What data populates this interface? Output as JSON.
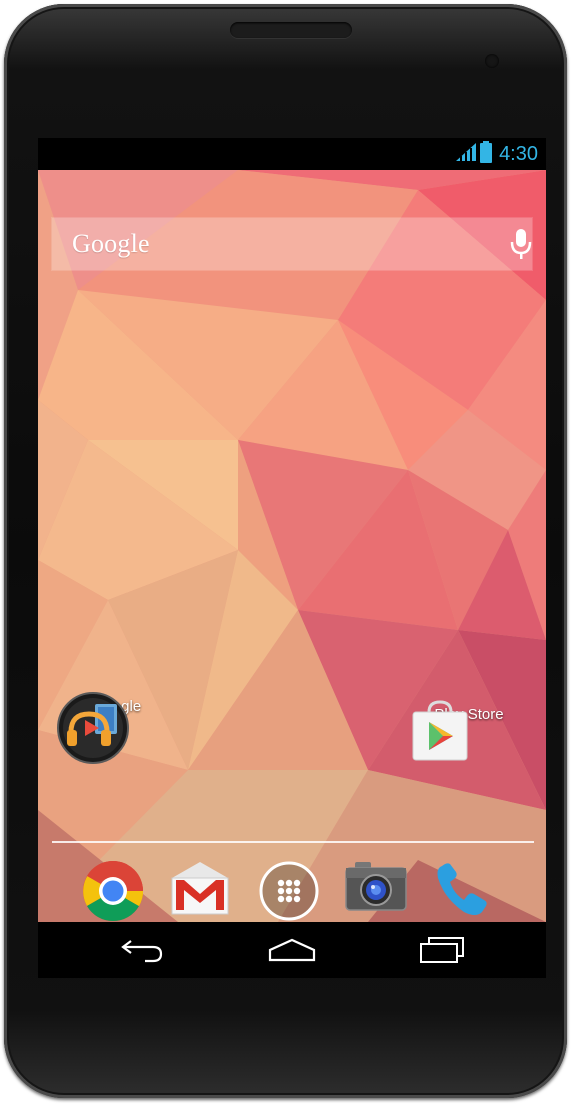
{
  "status_bar": {
    "time": "4:30",
    "icons": [
      "signal-icon",
      "battery-icon"
    ],
    "accent_color": "#33b5e5"
  },
  "search_widget": {
    "label": "Google",
    "icon": "mic-icon"
  },
  "home_apps": [
    {
      "label": "Google",
      "icon": "google-music-folder-icon"
    },
    {
      "label": "Play Store",
      "icon": "play-store-icon"
    }
  ],
  "dock": [
    {
      "icon": "chrome-icon"
    },
    {
      "icon": "gmail-icon"
    },
    {
      "icon": "app-drawer-icon"
    },
    {
      "icon": "camera-icon"
    },
    {
      "icon": "phone-icon"
    }
  ],
  "nav_bar": {
    "buttons": [
      "back-icon",
      "home-icon",
      "recents-icon"
    ]
  }
}
